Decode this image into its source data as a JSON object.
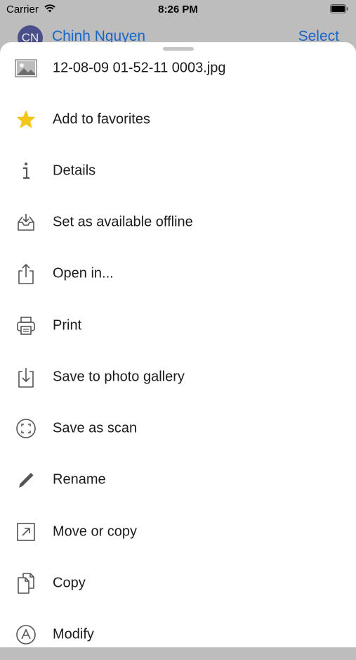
{
  "status_bar": {
    "carrier": "Carrier",
    "time": "8:26 PM",
    "icons": [
      "wifi-icon",
      "battery-icon"
    ]
  },
  "nav_bar": {
    "avatar_initials": "CN",
    "account_name": "Chinh Nguyen",
    "select_label": "Select",
    "accent_color": "#1a66c9"
  },
  "sheet": {
    "file": {
      "icon": "image-icon",
      "name": "12-08-09 01-52-11 0003.jpg"
    },
    "actions": [
      {
        "icon": "star-icon",
        "label": "Add to favorites"
      },
      {
        "icon": "info-icon",
        "label": "Details"
      },
      {
        "icon": "offline-tray-icon",
        "label": "Set as available offline"
      },
      {
        "icon": "share-icon",
        "label": "Open in..."
      },
      {
        "icon": "printer-icon",
        "label": "Print"
      },
      {
        "icon": "save-download-icon",
        "label": "Save to photo gallery"
      },
      {
        "icon": "scan-icon",
        "label": "Save as scan"
      },
      {
        "icon": "pencil-icon",
        "label": "Rename"
      },
      {
        "icon": "move-arrow-icon",
        "label": "Move or copy"
      },
      {
        "icon": "copy-pages-icon",
        "label": "Copy"
      },
      {
        "icon": "modify-icon",
        "label": "Modify"
      }
    ]
  }
}
